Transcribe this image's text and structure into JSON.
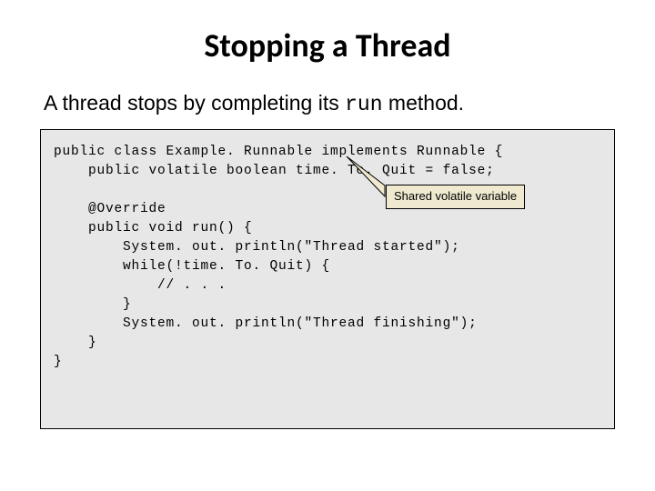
{
  "title": "Stopping a Thread",
  "subtitle": {
    "pre": "A thread stops by completing its ",
    "code": "run",
    "post": " method."
  },
  "callout": {
    "text": "Shared volatile variable"
  },
  "code": {
    "l1": "public class Example. Runnable implements Runnable {",
    "l2": "    public volatile boolean time. To. Quit = false;",
    "l3": "",
    "l4": "    @Override",
    "l5": "    public void run() {",
    "l6": "        System. out. println(\"Thread started\");",
    "l7": "        while(!time. To. Quit) {",
    "l8": "            // . . .",
    "l9": "        }",
    "l10": "        System. out. println(\"Thread finishing\");",
    "l11": "    }",
    "l12": "}"
  }
}
